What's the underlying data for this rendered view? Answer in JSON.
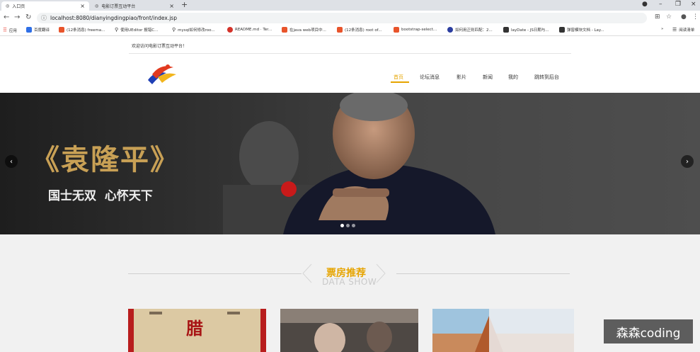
{
  "browser": {
    "tabs": [
      {
        "label": "入口页",
        "active": true
      },
      {
        "label": "电影订票互动平台",
        "active": false
      }
    ],
    "url": "localhost:8080/dianyingdingpiao/front/index.jsp",
    "bookmarks": [
      {
        "label": "应用",
        "color": "#e94235"
      },
      {
        "label": "百度翻译",
        "color": "#2f6fe6"
      },
      {
        "label": "(12条消息) freema...",
        "color": "#e8542b"
      },
      {
        "label": "使用UEditor 报错C...",
        "color": "#555555"
      },
      {
        "label": "mysql如何修改roo...",
        "color": "#555555"
      },
      {
        "label": "README.md · Ter...",
        "color": "#d4332a"
      },
      {
        "label": "在java web项目中...",
        "color": "#e8542b"
      },
      {
        "label": "(12条消息) root of...",
        "color": "#e8542b"
      },
      {
        "label": "bootstrap-select...",
        "color": "#e8542b"
      },
      {
        "label": "如何用正则匹配：2...",
        "color": "#2c3ea0"
      },
      {
        "label": "layDate - JS日期与...",
        "color": "#333333"
      },
      {
        "label": "弹窗模块文档 - Lay...",
        "color": "#333333"
      },
      {
        "label": "阅读清单",
        "color": "#555555"
      }
    ],
    "bookmarks_more": "»"
  },
  "site": {
    "welcome": "欢迎访问电影订票互动平台！",
    "nav": [
      {
        "label": "首页",
        "active": true
      },
      {
        "label": "论坛消息",
        "active": false
      },
      {
        "label": "影片",
        "active": false
      },
      {
        "label": "新闻",
        "active": false
      },
      {
        "label": "我的",
        "active": false
      },
      {
        "label": "跳转到后台",
        "active": false
      }
    ],
    "banner": {
      "title": "《袁隆平》",
      "subtitle": "国士无双  心怀天下",
      "slide_count": 3,
      "active_slide": 1
    },
    "section": {
      "title": "票房推荐",
      "subtitle": "DATA SHOW"
    },
    "poster1_text": "腊"
  },
  "overlay": {
    "watermark": "森森coding"
  },
  "colors": {
    "accent": "#e6a400",
    "tabbar": "#dee1e6"
  }
}
